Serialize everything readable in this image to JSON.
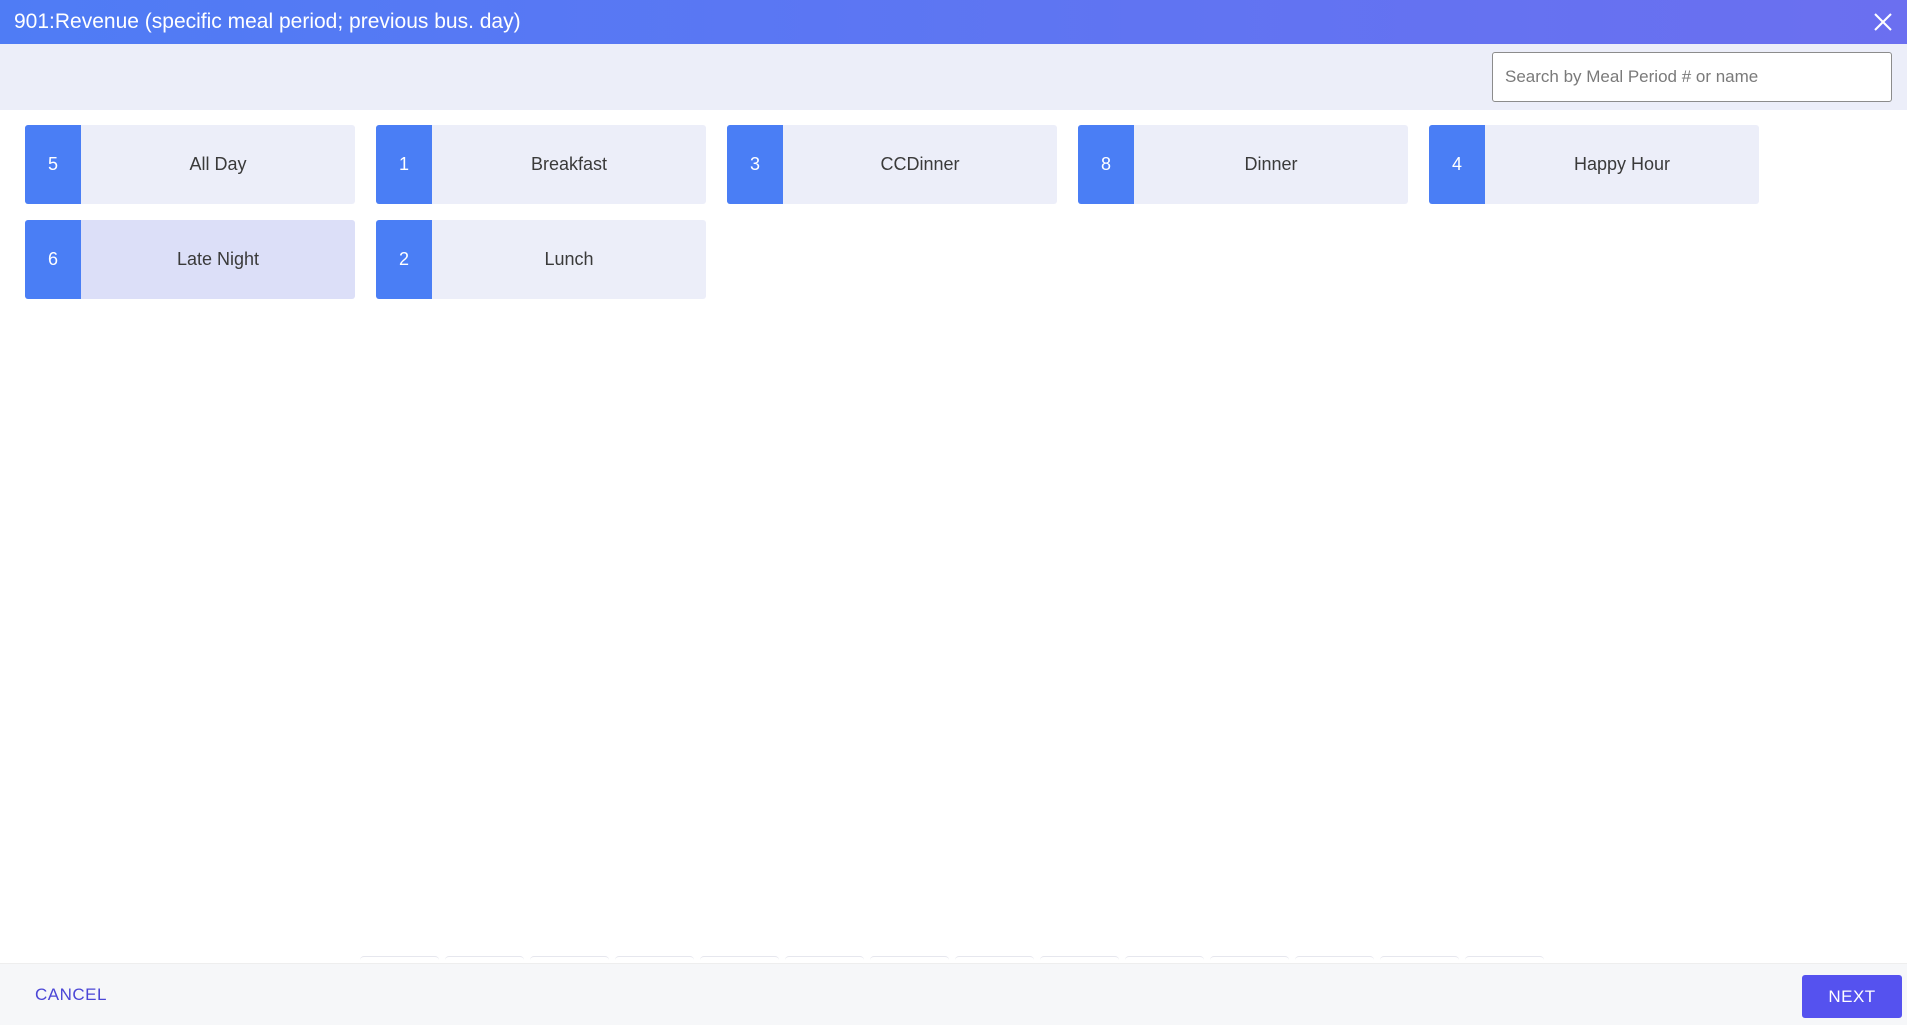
{
  "window": {
    "title": "901:Revenue (specific meal period; previous bus. day)",
    "close_icon": "close-icon"
  },
  "search": {
    "placeholder": "Search by Meal Period # or name",
    "value": ""
  },
  "meal_periods": [
    {
      "number": "5",
      "name": "All Day",
      "selected": false
    },
    {
      "number": "1",
      "name": "Breakfast",
      "selected": false
    },
    {
      "number": "3",
      "name": "CCDinner",
      "selected": false
    },
    {
      "number": "8",
      "name": "Dinner",
      "selected": false
    },
    {
      "number": "4",
      "name": "Happy Hour",
      "selected": false
    },
    {
      "number": "6",
      "name": "Late Night",
      "selected": true
    },
    {
      "number": "2",
      "name": "Lunch",
      "selected": false
    }
  ],
  "footer": {
    "cancel_label": "CANCEL",
    "next_label": "NEXT"
  },
  "colors": {
    "titlebar_start": "#4f7cf5",
    "titlebar_end": "#6b6ff0",
    "number_badge": "#4a7ef5",
    "card_bg": "#eceef9",
    "card_selected_bg": "#dcdff8",
    "primary_button": "#5552ef",
    "cancel_text": "#4b46d6"
  }
}
